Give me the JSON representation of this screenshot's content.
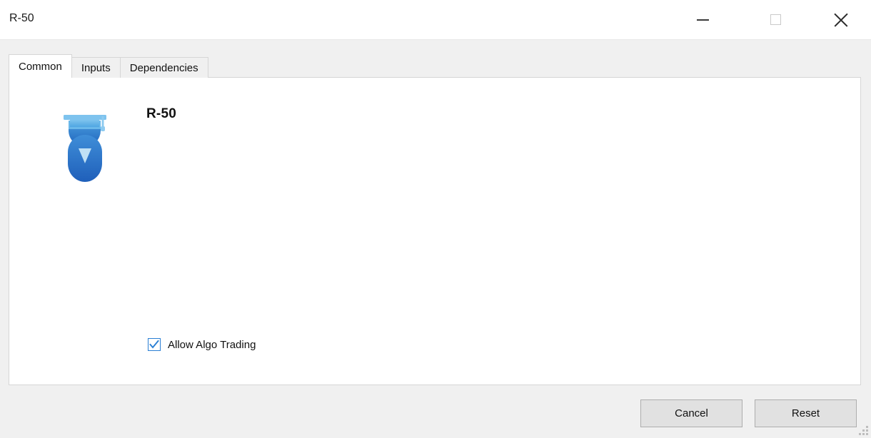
{
  "window": {
    "title": "R-50",
    "controls": {
      "minimize": "minimize-icon",
      "maximize": "maximize-icon",
      "close": "close-icon"
    }
  },
  "tabs": [
    {
      "label": "Common",
      "active": true
    },
    {
      "label": "Inputs",
      "active": false
    },
    {
      "label": "Dependencies",
      "active": false
    }
  ],
  "common_tab": {
    "icon": "expert-advisor-graduate-icon",
    "expert_name": "R-50",
    "allow_algo_trading": {
      "label": "Allow Algo Trading",
      "checked": true
    }
  },
  "footer": {
    "cancel_label": "Cancel",
    "reset_label": "Reset"
  },
  "colors": {
    "accent": "#2a7fd4",
    "icon_light_blue": "#69b4e8",
    "icon_blue": "#2f6fc4",
    "window_background": "#f0f0f0",
    "panel_background": "#ffffff",
    "button_face": "#e1e1e1",
    "border": "#d6d6d6"
  }
}
